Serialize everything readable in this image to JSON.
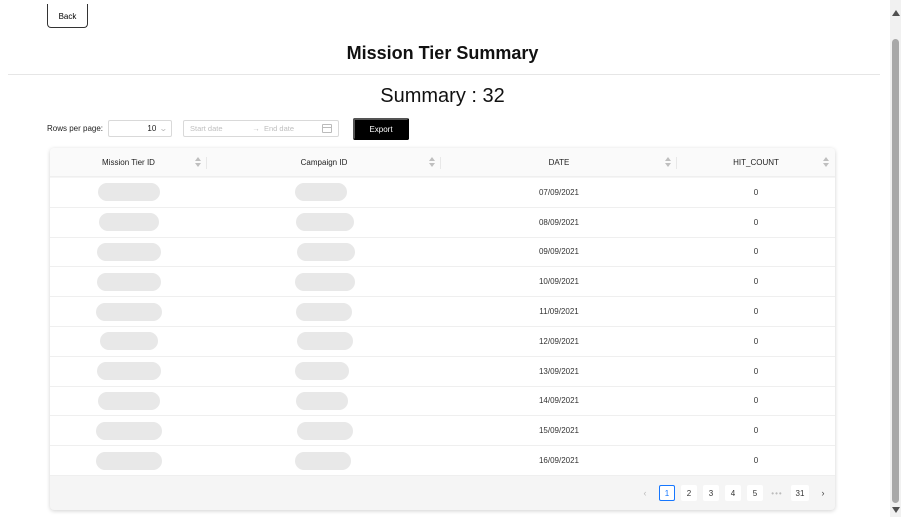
{
  "back_label": "Back",
  "page_title": "Mission Tier Summary",
  "summary_text": "Summary : 32",
  "controls": {
    "rows_per_page_label": "Rows per page:",
    "rows_per_page_value": "10",
    "start_date_placeholder": "Start date",
    "end_date_placeholder": "End date",
    "export_label": "Export"
  },
  "table": {
    "columns": [
      "Mission Tier ID",
      "Campaign ID",
      "DATE",
      "HIT_COUNT"
    ],
    "rows": [
      {
        "date": "07/09/2021",
        "hit_count": "0"
      },
      {
        "date": "08/09/2021",
        "hit_count": "0"
      },
      {
        "date": "09/09/2021",
        "hit_count": "0"
      },
      {
        "date": "10/09/2021",
        "hit_count": "0"
      },
      {
        "date": "11/09/2021",
        "hit_count": "0"
      },
      {
        "date": "12/09/2021",
        "hit_count": "0"
      },
      {
        "date": "13/09/2021",
        "hit_count": "0"
      },
      {
        "date": "14/09/2021",
        "hit_count": "0"
      },
      {
        "date": "15/09/2021",
        "hit_count": "0"
      },
      {
        "date": "16/09/2021",
        "hit_count": "0"
      }
    ]
  },
  "pagination": {
    "pages": [
      "1",
      "2",
      "3",
      "4",
      "5"
    ],
    "active_page": "1",
    "ellipsis": "•••",
    "last_page": "31"
  },
  "colors": {
    "accent": "#1677ff",
    "export_button": "#000000",
    "skeleton": "#e8e8e8"
  }
}
